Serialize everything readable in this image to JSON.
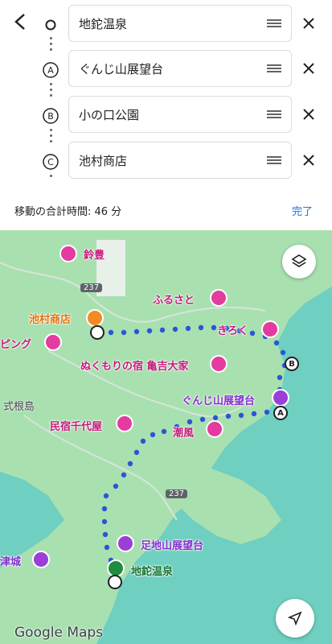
{
  "header": {
    "back_icon": "arrow-back-icon",
    "stops": [
      {
        "marker": "○",
        "text": "地鉈温泉"
      },
      {
        "marker": "A",
        "text": "ぐんじ山展望台"
      },
      {
        "marker": "B",
        "text": "小の口公園"
      },
      {
        "marker": "C",
        "text": "池村商店"
      }
    ],
    "total_label": "移動の合計時間: 46 分",
    "done_label": "完了"
  },
  "map": {
    "places": {
      "suzutoyo": "鈴豊",
      "ikemura": "池村商店",
      "furusato": "ふるさと",
      "kiroku": "きろく",
      "ping": "ピング",
      "nukumori": "ぬくもりの宿 亀吉大家",
      "gunji": "ぐんじ山展望台",
      "shikineshima": "式根島",
      "chiyoya": "民宿千代屋",
      "shiokaze": "潮風",
      "ashitsuki": "足地山展望台",
      "tsujiro": "津城",
      "jinata": "地鉈温泉"
    },
    "road_badges": [
      "237",
      "237"
    ],
    "waypoints": [
      "B",
      "A"
    ],
    "attribution": "Google Maps",
    "route_color": "#2a56d6"
  },
  "colors": {
    "accent": "#1a73e8",
    "sea": "#6fcfc0",
    "land": "#a9e0b0"
  }
}
